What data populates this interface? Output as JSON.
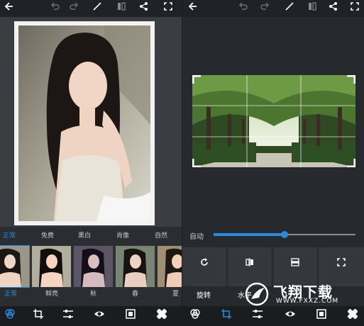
{
  "left": {
    "filter_labels": [
      {
        "label": "正常",
        "active": true
      },
      {
        "label": "免费",
        "active": false
      },
      {
        "label": "黑白",
        "active": false
      },
      {
        "label": "肖像",
        "active": false
      },
      {
        "label": "自然",
        "active": false
      }
    ],
    "thumb_names": [
      {
        "label": "正常",
        "active": true
      },
      {
        "label": "鲜亮",
        "active": false
      },
      {
        "label": "秋",
        "active": false
      },
      {
        "label": "春",
        "active": false
      },
      {
        "label": "夏",
        "active": false
      }
    ],
    "icons": {
      "back": "back-arrow-icon",
      "undo": "undo-icon",
      "redo": "redo-icon",
      "magic": "magic-wand-icon",
      "compare": "compare-icon",
      "share": "share-icon",
      "fullscreen": "fullscreen-icon"
    }
  },
  "right": {
    "auto_label": "自动",
    "slider_value": 0.4,
    "tools": [
      {
        "label": "旋转",
        "icon": "rotate-icon"
      },
      {
        "label": "水平",
        "icon": "flip-horizontal-icon"
      },
      {
        "label": "",
        "icon": "flip-vertical-icon"
      },
      {
        "label": "",
        "icon": "crop-fit-icon"
      }
    ]
  },
  "watermark": {
    "brand": "飞翔下载",
    "url": "WWW.FXXZ.COM"
  },
  "colors": {
    "accent": "#2b8be0",
    "background": "#2a2d31",
    "topbar": "#1f2226"
  }
}
